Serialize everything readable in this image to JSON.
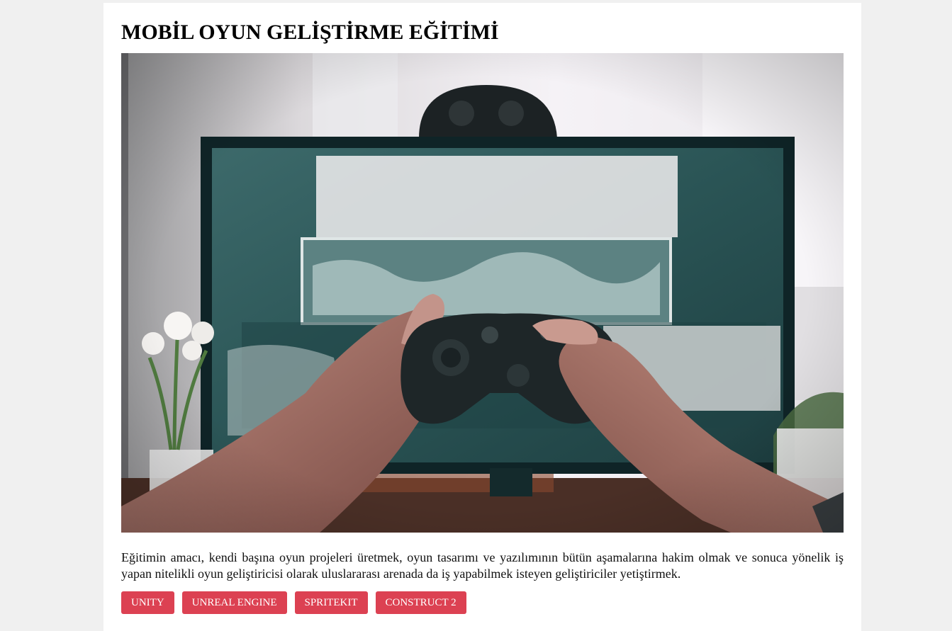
{
  "course": {
    "title": "MOBİL OYUN GELİŞTİRME EĞİTİMİ",
    "image": {
      "subject": "hands-holding-game-controller-in-front-of-monitor",
      "colors": {
        "wall": "#e9e6ea",
        "window": "#f6f3f7",
        "monitor_frame": "#0f2427",
        "screen": "#2f5c5d",
        "skin": "#a9756a",
        "controller": "#1e2628"
      }
    },
    "description": "Eğitimin amacı, kendi başına oyun projeleri üretmek, oyun tasarımı ve yazılımının bütün aşamalarına hakim olmak ve sonuca yönelik iş yapan nitelikli oyun geliştiricisi olarak uluslararası arenada da iş yapabilmek isteyen geliştiriciler yetiştirmek.",
    "tags": [
      {
        "label": "UNITY"
      },
      {
        "label": "UNREAL ENGINE"
      },
      {
        "label": "SPRITEKIT"
      },
      {
        "label": "CONSTRUCT 2"
      }
    ],
    "tag_color": "#dc4152"
  }
}
